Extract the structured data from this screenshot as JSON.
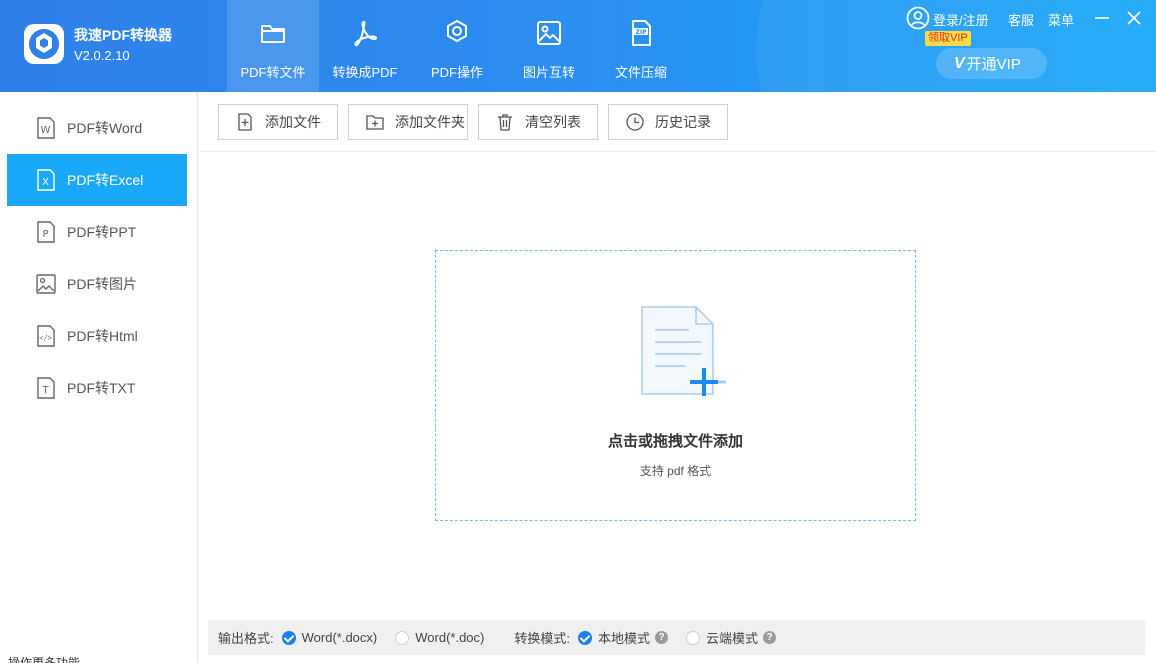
{
  "app": {
    "name": "我速PDF转换器",
    "version": "V2.0.2.10"
  },
  "nav": {
    "tabs": [
      {
        "label": "PDF转文件",
        "icon": "folder-icon",
        "active": true
      },
      {
        "label": "转换成PDF",
        "icon": "acrobat-icon",
        "active": false
      },
      {
        "label": "PDF操作",
        "icon": "gear-icon",
        "active": false
      },
      {
        "label": "图片互转",
        "icon": "image-icon",
        "active": false
      },
      {
        "label": "文件压缩",
        "icon": "zip-icon",
        "active": false
      }
    ]
  },
  "top_right": {
    "login": "登录/注册",
    "service": "客服",
    "menu": "菜单",
    "vip_badge": "领取VIP",
    "vip_mark": "V",
    "vip_button": "开通VIP"
  },
  "sidebar": {
    "items": [
      {
        "label": "PDF转Word",
        "icon_letter": "W",
        "active": false
      },
      {
        "label": "PDF转Excel",
        "icon_letter": "X",
        "active": true
      },
      {
        "label": "PDF转PPT",
        "icon_letter": "P",
        "active": false
      },
      {
        "label": "PDF转图片",
        "icon_letter": "",
        "active": false
      },
      {
        "label": "PDF转Html",
        "icon_letter": "</>",
        "active": false
      },
      {
        "label": "PDF转TXT",
        "icon_letter": "T",
        "active": false
      }
    ],
    "footer": "操作更多功能"
  },
  "toolbar": {
    "add_file": "添加文件",
    "add_folder": "添加文件夹",
    "clear_list": "清空列表",
    "history": "历史记录"
  },
  "drop_zone": {
    "title": "点击或拖拽文件添加",
    "hint": "支持 pdf 格式"
  },
  "bottom_bar": {
    "output_label": "输出格式:",
    "output_options": [
      {
        "label": "Word(*.docx)",
        "checked": true
      },
      {
        "label": "Word(*.doc)",
        "checked": false
      }
    ],
    "mode_label": "转换模式:",
    "mode_options": [
      {
        "label": "本地模式",
        "checked": true,
        "help": "?"
      },
      {
        "label": "云端模式",
        "checked": false,
        "help": "?"
      }
    ]
  },
  "colors": {
    "header_start": "#2f80e8",
    "header_end": "#1aa8f8",
    "active_sidebar": "#1aa8f8",
    "radio_checked": "#1a7ff2",
    "dashed_border": "#7cb8e9"
  }
}
